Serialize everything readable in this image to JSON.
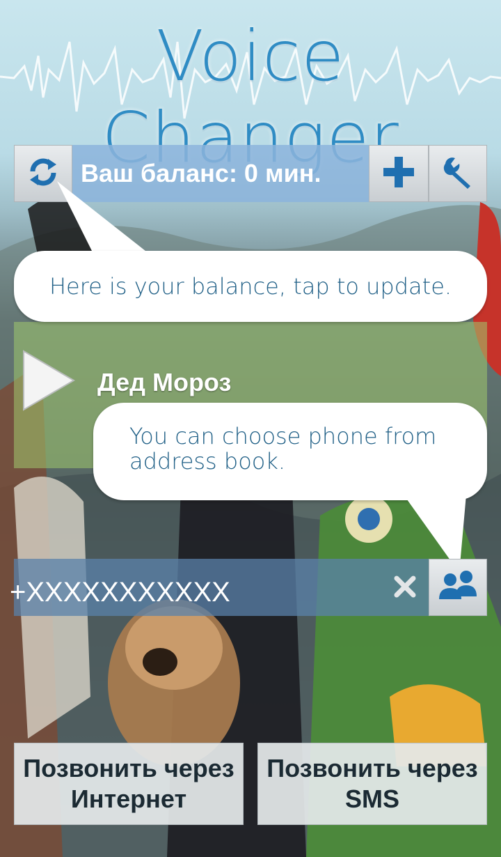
{
  "app": {
    "title": "Voice Changer"
  },
  "balance": {
    "text": "Ваш баланс: 0 мин."
  },
  "icons": {
    "refresh": "refresh-icon",
    "add": "plus-icon",
    "settings": "wrench-icon",
    "play": "play-icon",
    "clear": "close-icon",
    "contacts": "contacts-icon"
  },
  "tooltips": {
    "balance": "Here is your balance, tap to update.",
    "contacts": "You can choose phone from address book."
  },
  "voice": {
    "selected": "Дед Мороз"
  },
  "phone": {
    "placeholder": "+XXXXXXXXXXX"
  },
  "actions": {
    "call_internet": {
      "line1": "Позвонить через",
      "line2": "Интернет"
    },
    "call_sms": {
      "line1": "Позвонить через",
      "line2": "SMS"
    }
  },
  "colors": {
    "accent": "#2f8cc4",
    "tooltip_text": "#1f5f86",
    "icon_blue": "#1f6fb0"
  }
}
